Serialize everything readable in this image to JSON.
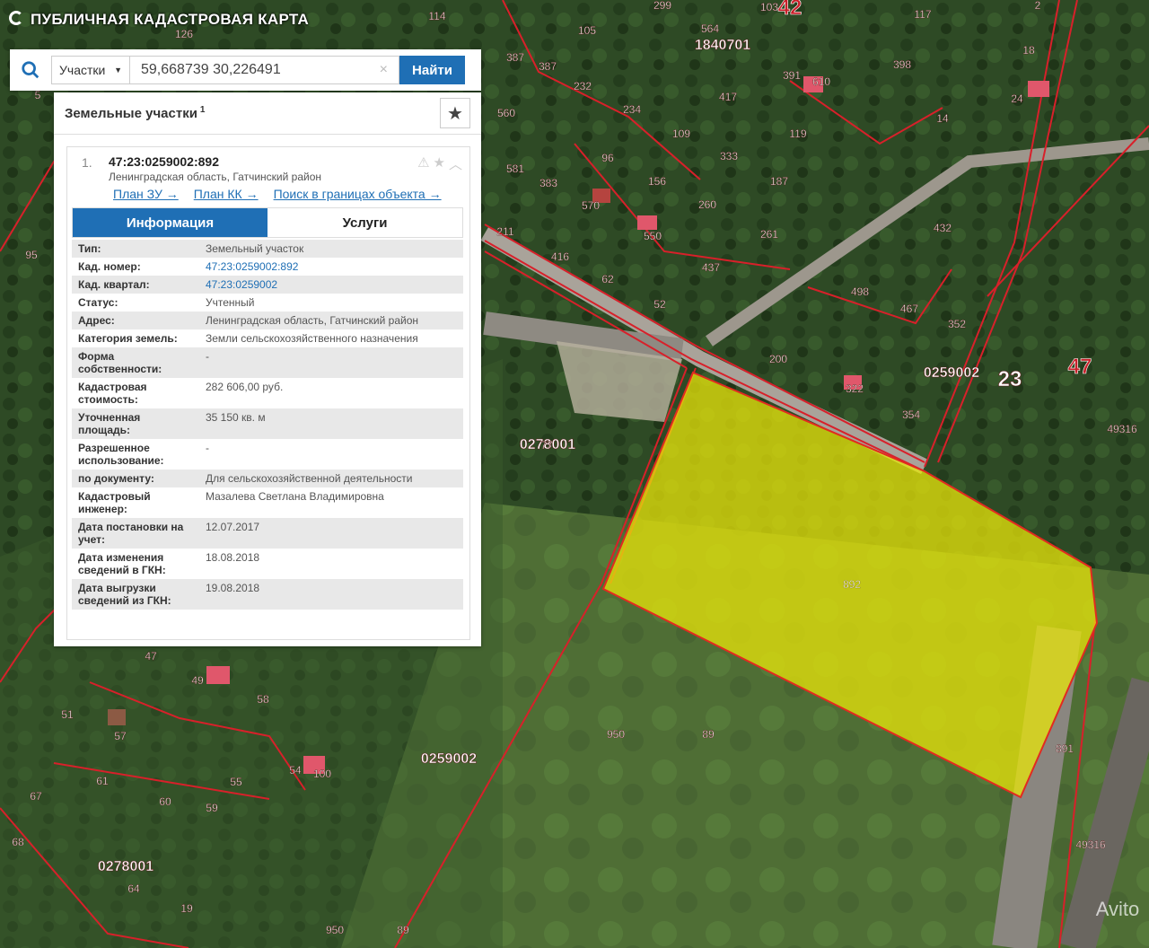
{
  "app": {
    "title": "ПУБЛИЧНАЯ КАДАСТРОВАЯ КАРТА"
  },
  "search": {
    "type_label": "Участки",
    "query": "59,668739 30,226491",
    "button_label": "Найти"
  },
  "panel": {
    "title": "Земельные участки",
    "count": "1",
    "result": {
      "number": "1.",
      "id": "47:23:0259002:892",
      "address": "Ленинградская область, Гатчинский район",
      "links": [
        "План ЗУ →",
        "План КК →",
        "Поиск в границах объекта →"
      ],
      "tabs": [
        "Информация",
        "Услуги"
      ],
      "rows": [
        [
          "Тип:",
          "Земельный участок"
        ],
        [
          "Кад. номер:",
          "47:23:0259002:892"
        ],
        [
          "Кад. квартал:",
          "47:23:0259002"
        ],
        [
          "Статус:",
          "Учтенный"
        ],
        [
          "Адрес:",
          "Ленинградская область, Гатчинский район"
        ],
        [
          "Категория земель:",
          "Земли сельскохозяйственного назначения"
        ],
        [
          "Форма собственности:",
          "-"
        ],
        [
          "Кадастровая стоимость:",
          "282 606,00 руб."
        ],
        [
          "Уточненная площадь:",
          "35 150 кв. м"
        ],
        [
          "Разрешенное использование:",
          "-"
        ],
        [
          "по документу:",
          "Для сельскохозяйственной деятельности"
        ],
        [
          "Кадастровый инженер:",
          "Мазалева Светлана Владимировна"
        ],
        [
          "Дата постановки на учет:",
          "12.07.2017"
        ],
        [
          "Дата изменения сведений в ГКН:",
          "18.08.2018"
        ],
        [
          "Дата выгрузки сведений из ГКН:",
          "19.08.2018"
        ]
      ]
    }
  },
  "map": {
    "highlight_label": "892",
    "labels": [
      "0278001",
      "0259002",
      "0278001",
      "0259002",
      "1840701",
      "42",
      "47",
      "23",
      "49316",
      "49316",
      "950",
      "89",
      "891",
      "114",
      "126",
      "299",
      "103",
      "117",
      "2",
      "564",
      "105",
      "387",
      "387",
      "18",
      "232",
      "391",
      "610",
      "398",
      "24",
      "560",
      "234",
      "417",
      "109",
      "119",
      "14",
      "581",
      "383",
      "96",
      "333",
      "187",
      "570",
      "156",
      "260",
      "432",
      "211",
      "550",
      "261",
      "416",
      "437",
      "498",
      "62",
      "467",
      "352",
      "52",
      "200",
      "322",
      "354",
      "77",
      "47",
      "49",
      "58",
      "51",
      "57",
      "54",
      "100",
      "61",
      "55",
      "60",
      "59",
      "67",
      "68",
      "64",
      "19",
      "950",
      "89",
      "5",
      "95"
    ],
    "colors": {
      "highlight": "#e8e60a",
      "boundary": "#d8202a"
    }
  },
  "watermark": "Avito"
}
